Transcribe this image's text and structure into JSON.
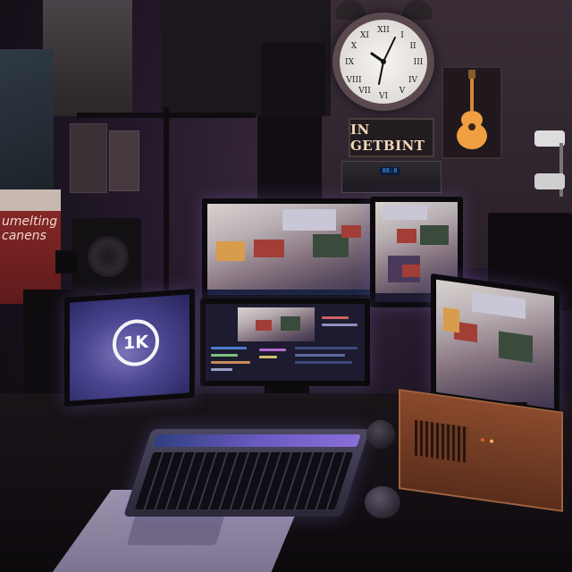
{
  "scene": {
    "wall_sign_text": "IN GETBINT",
    "red_poster_text": "umelting\ncanens",
    "monitor_logo_text": "1K",
    "receiver_display_text": "88:8"
  },
  "colors": {
    "ambient": "#24192a",
    "screen_glow": "#7a74b8",
    "wood_case": "#8a4a2c",
    "keyboard_accent": "#6a5ac0"
  },
  "icons": [
    "clock-icon",
    "guitar-icon",
    "k-logo-icon",
    "security-camera-icon",
    "speaker-icon"
  ]
}
